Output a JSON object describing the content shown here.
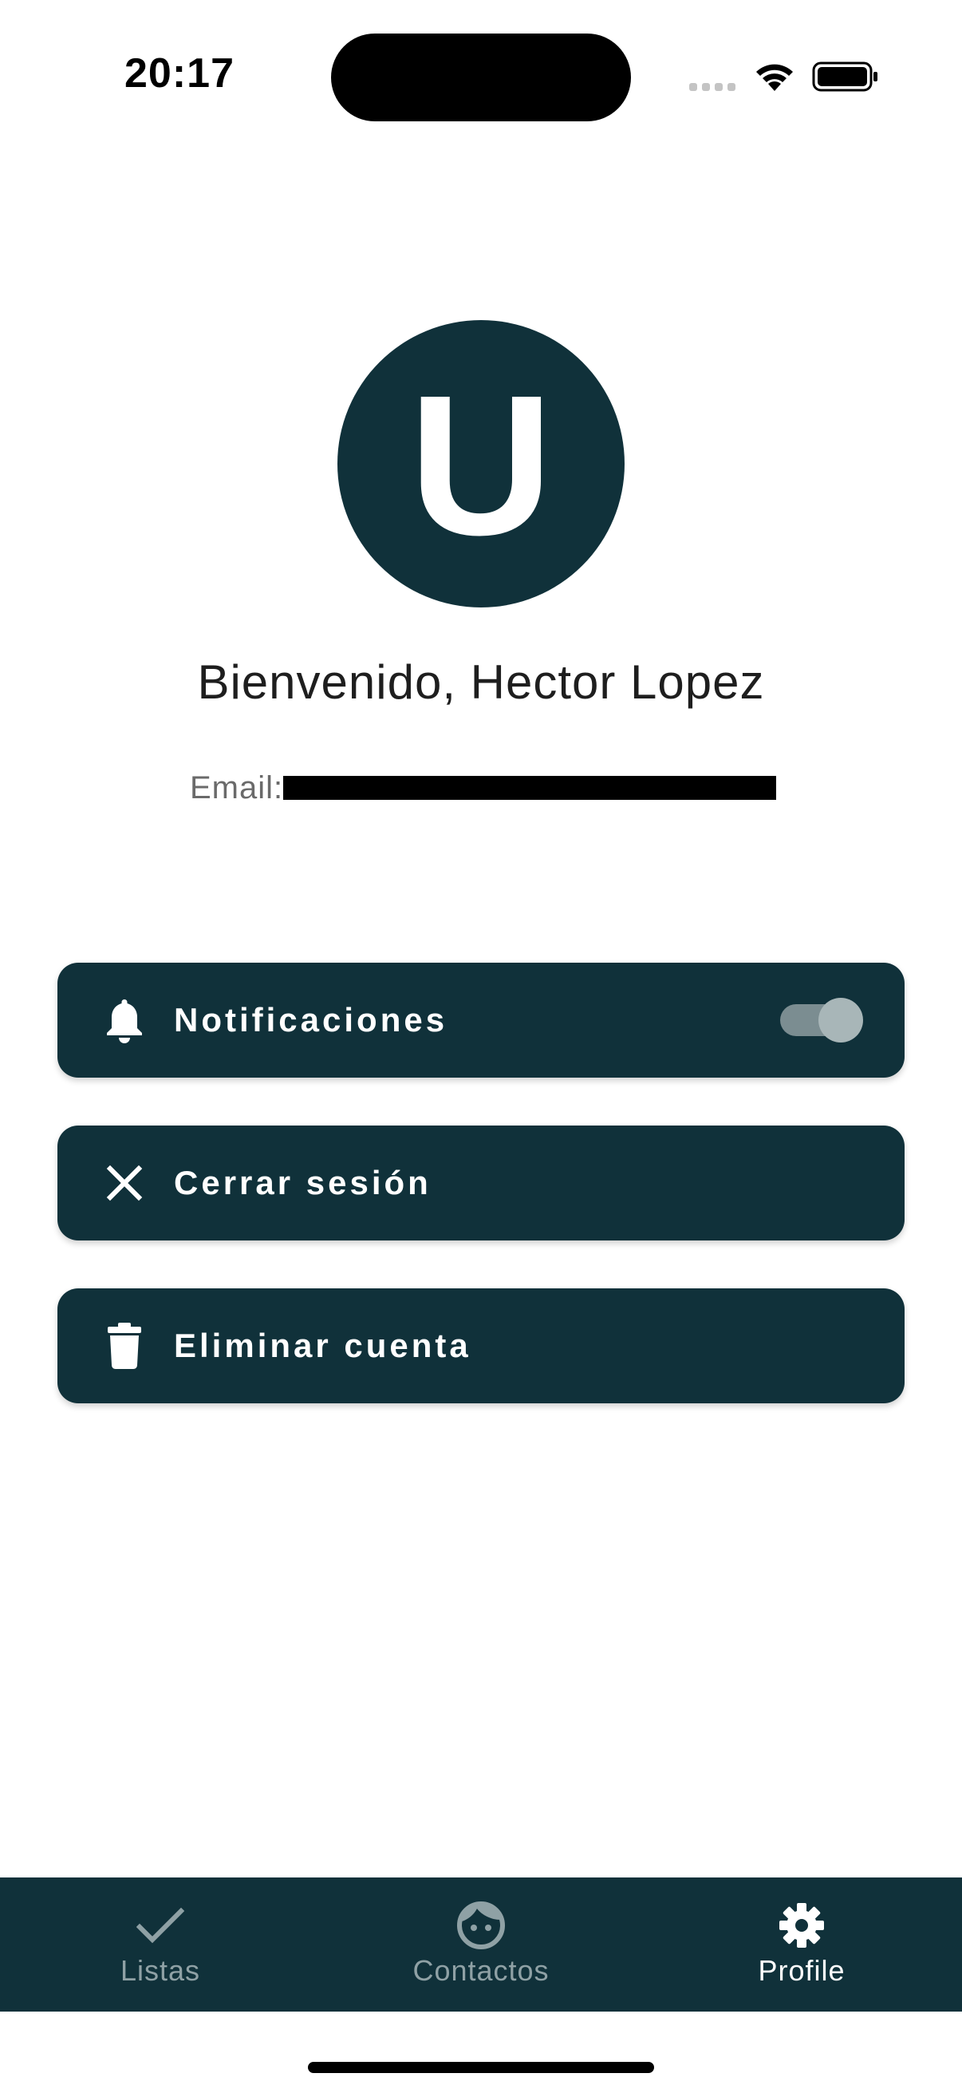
{
  "status_bar": {
    "time": "20:17"
  },
  "profile": {
    "avatar_letter": "U",
    "welcome_text": "Bienvenido, Hector Lopez",
    "email_label": "Email:"
  },
  "actions": {
    "notifications_label": "Notificaciones",
    "notifications_enabled": true,
    "logout_label": "Cerrar sesión",
    "delete_label": "Eliminar cuenta"
  },
  "bottom_nav": {
    "items": [
      {
        "label": "Listas",
        "icon": "check-icon",
        "active": false
      },
      {
        "label": "Contactos",
        "icon": "face-icon",
        "active": false
      },
      {
        "label": "Profile",
        "icon": "gear-icon",
        "active": true
      }
    ]
  },
  "colors": {
    "primary": "#10313a",
    "nav_inactive": "#8fa1a5",
    "nav_active": "#ffffff"
  }
}
